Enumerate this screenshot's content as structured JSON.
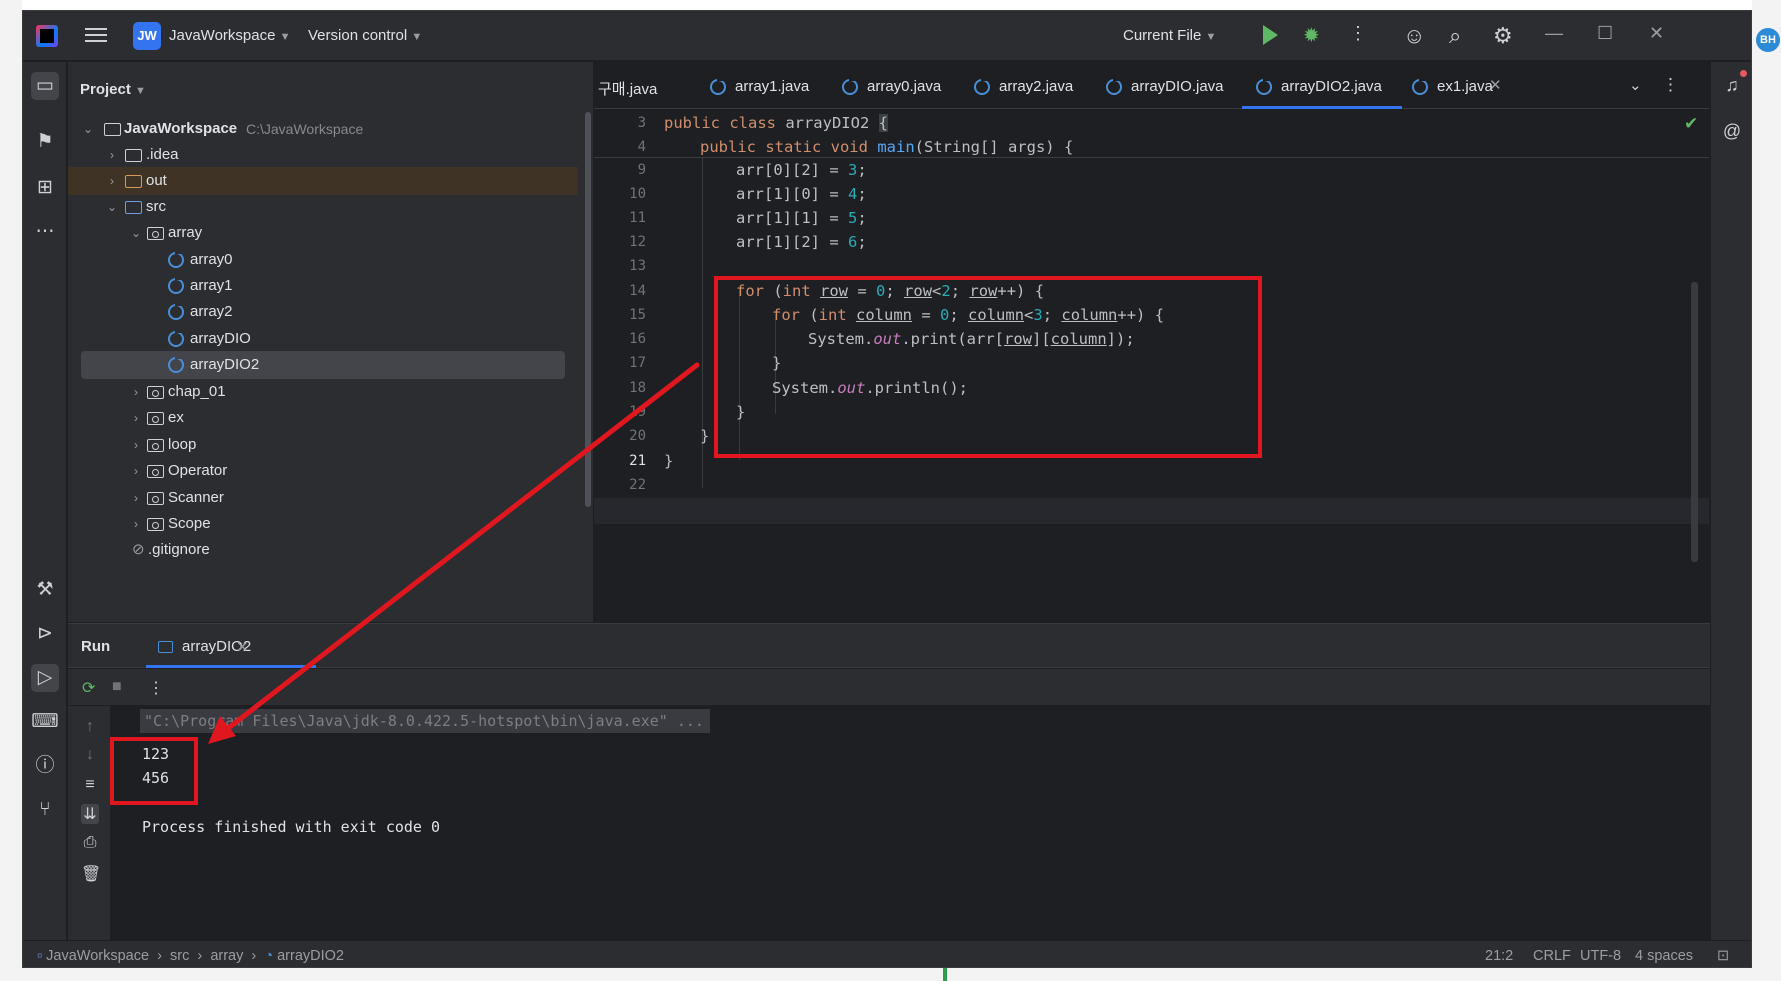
{
  "titlebar": {
    "project_badge": "JW",
    "project_name": "JavaWorkspace",
    "version_control": "Version control",
    "run_config": "Current File",
    "avatar": "BH"
  },
  "project_panel": {
    "title": "Project",
    "root": {
      "label": "JavaWorkspace",
      "path": "C:\\JavaWorkspace"
    },
    "items": [
      {
        "label": ".idea"
      },
      {
        "label": "out"
      },
      {
        "label": "src"
      },
      {
        "label": "array"
      },
      {
        "label": "array0"
      },
      {
        "label": "array1"
      },
      {
        "label": "array2"
      },
      {
        "label": "arrayDIO"
      },
      {
        "label": "arrayDIO2"
      },
      {
        "label": "chap_01"
      },
      {
        "label": "ex"
      },
      {
        "label": "loop"
      },
      {
        "label": "Operator"
      },
      {
        "label": "Scanner"
      },
      {
        "label": "Scope"
      },
      {
        "label": ".gitignore"
      }
    ]
  },
  "editor": {
    "tabs": [
      {
        "label": "구매.java"
      },
      {
        "label": "array1.java"
      },
      {
        "label": "array0.java"
      },
      {
        "label": "array2.java"
      },
      {
        "label": "arrayDIO.java"
      },
      {
        "label": "arrayDIO2.java",
        "active": true
      },
      {
        "label": "ex1.java"
      }
    ],
    "sticky_lines": [
      {
        "num": "3",
        "text": "public class arrayDIO2 {"
      },
      {
        "num": "4",
        "text": "    public static void main(String[] args) {"
      }
    ],
    "line_numbers": [
      "9",
      "10",
      "11",
      "12",
      "13",
      "14",
      "15",
      "16",
      "17",
      "18",
      "19",
      "20",
      "21",
      "22"
    ],
    "code": {
      "l9_a": "arr[0][2] = ",
      "l9_b": "3",
      "l9_c": ";",
      "l10_a": "arr[1][0] = ",
      "l10_b": "4",
      "l10_c": ";",
      "l11_a": "arr[1][1] = ",
      "l11_b": "5",
      "l11_c": ";",
      "l12_a": "arr[1][2] = ",
      "l12_b": "6",
      "l12_c": ";"
    },
    "current_line": "21"
  },
  "run_panel": {
    "title": "Run",
    "tab": "arrayDIO2",
    "command": "\"C:\\Program Files\\Java\\jdk-8.0.422.5-hotspot\\bin\\java.exe\" ...",
    "output": [
      "123",
      "456"
    ],
    "exit_message": "Process finished with exit code 0"
  },
  "statusbar": {
    "breadcrumb": [
      "JavaWorkspace",
      "src",
      "array",
      "arrayDIO2"
    ],
    "position": "21:2",
    "line_ending": "CRLF",
    "encoding": "UTF-8",
    "indent": "4 spaces"
  },
  "colors": {
    "annotation_red": "#e0171f",
    "accent_blue": "#3574f0",
    "run_green": "#5fb865"
  }
}
